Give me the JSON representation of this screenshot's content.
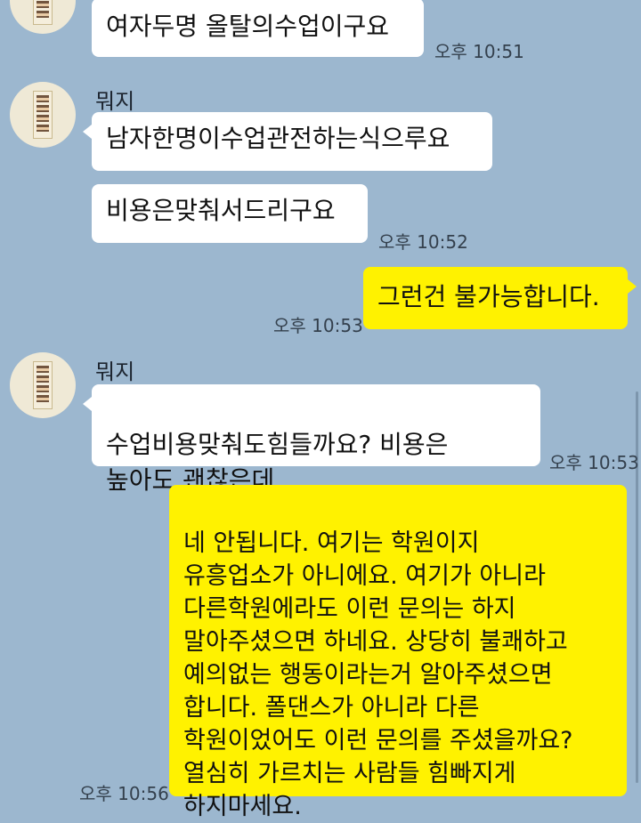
{
  "messages": [
    {
      "sender": "",
      "text": "여자두명 올탈의수업이구요",
      "time": "오후 10:51"
    },
    {
      "sender": "뭐지",
      "text": "남자한명이수업관전하는식으루요",
      "time": ""
    },
    {
      "sender": "",
      "text": "비용은맞춰서드리구요",
      "time": "오후 10:52"
    },
    {
      "sender": "me",
      "text": "그런건 불가능합니다.",
      "time": "오후 10:53"
    },
    {
      "sender": "뭐지",
      "text": "수업비용맞춰도힘들까요? 비용은\n높아도 괜찮은데..",
      "time": "오후 10:53"
    },
    {
      "sender": "me",
      "text": "네 안됩니다. 여기는 학원이지\n유흥업소가 아니에요. 여기가 아니라\n다른학원에라도 이런 문의는 하지\n말아주셨으면 하네요. 상당히 불쾌하고\n예의없는 행동이라는거 알아주셨으면\n합니다. 폴댄스가 아니라 다른\n학원이었어도 이런 문의를 주셨을까요?\n열심히 가르치는 사람들 힘빠지게\n하지마세요.",
      "time": "오후 10:56"
    }
  ],
  "colors": {
    "background": "#9cb7cf",
    "incoming_bubble": "#ffffff",
    "outgoing_bubble": "#fff200"
  }
}
